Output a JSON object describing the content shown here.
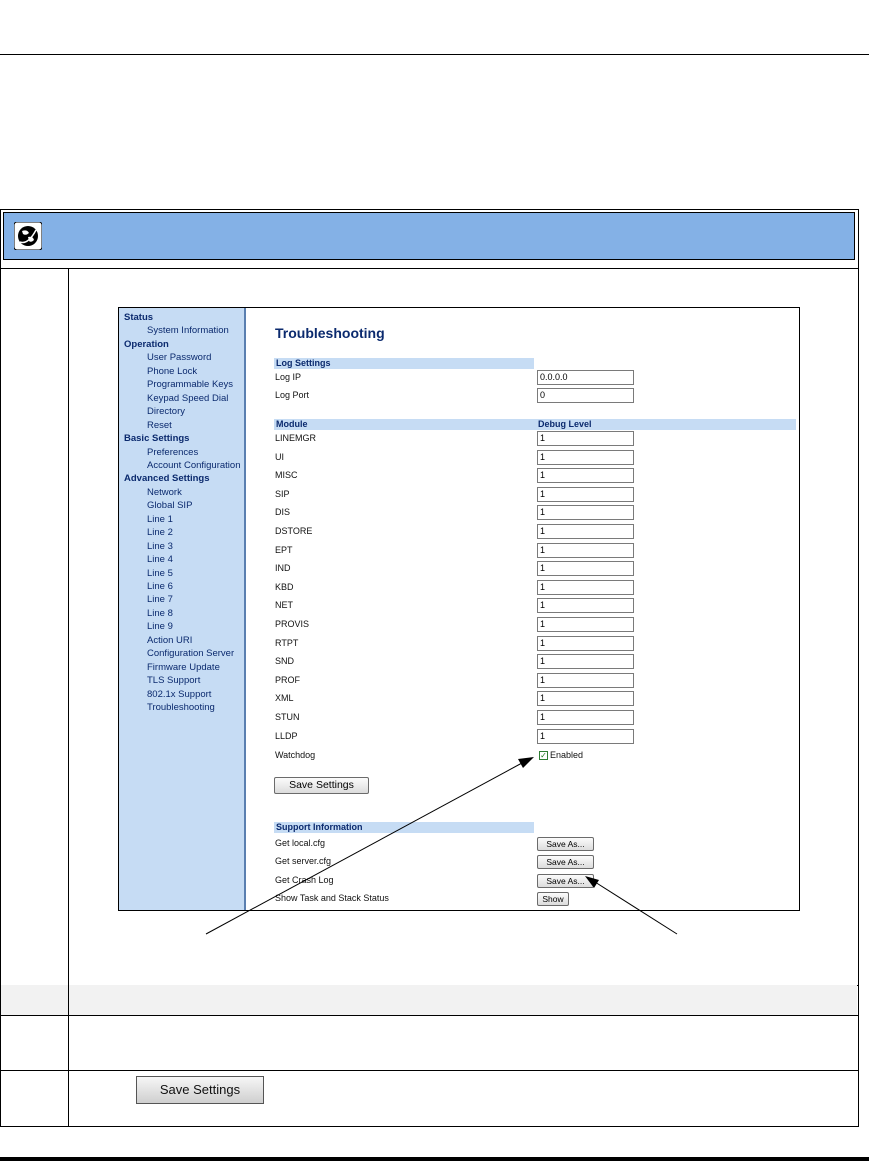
{
  "webui": {
    "page_title": "Troubleshooting",
    "nav": [
      {
        "label": "Status",
        "level": "h"
      },
      {
        "label": "System Information",
        "level": "s"
      },
      {
        "label": "Operation",
        "level": "h"
      },
      {
        "label": "User Password",
        "level": "s"
      },
      {
        "label": "Phone Lock",
        "level": "s"
      },
      {
        "label": "Programmable Keys",
        "level": "s"
      },
      {
        "label": "Keypad Speed Dial",
        "level": "s"
      },
      {
        "label": "Directory",
        "level": "s"
      },
      {
        "label": "Reset",
        "level": "s"
      },
      {
        "label": "Basic Settings",
        "level": "h"
      },
      {
        "label": "Preferences",
        "level": "s"
      },
      {
        "label": "Account Configuration",
        "level": "s"
      },
      {
        "label": "Advanced Settings",
        "level": "h"
      },
      {
        "label": "Network",
        "level": "s"
      },
      {
        "label": "Global SIP",
        "level": "s"
      },
      {
        "label": "Line 1",
        "level": "s"
      },
      {
        "label": "Line 2",
        "level": "s"
      },
      {
        "label": "Line 3",
        "level": "s"
      },
      {
        "label": "Line 4",
        "level": "s"
      },
      {
        "label": "Line 5",
        "level": "s"
      },
      {
        "label": "Line 6",
        "level": "s"
      },
      {
        "label": "Line 7",
        "level": "s"
      },
      {
        "label": "Line 8",
        "level": "s"
      },
      {
        "label": "Line 9",
        "level": "s"
      },
      {
        "label": "Action URI",
        "level": "s"
      },
      {
        "label": "Configuration Server",
        "level": "s"
      },
      {
        "label": "Firmware Update",
        "level": "s"
      },
      {
        "label": "TLS Support",
        "level": "s"
      },
      {
        "label": "802.1x Support",
        "level": "s"
      },
      {
        "label": "Troubleshooting",
        "level": "s"
      }
    ],
    "log_settings": {
      "header": "Log Settings",
      "rows": [
        {
          "label": "Log IP",
          "value": "0.0.0.0"
        },
        {
          "label": "Log Port",
          "value": "0"
        }
      ]
    },
    "modules": {
      "header_module": "Module",
      "header_level": "Debug Level",
      "rows": [
        {
          "label": "LINEMGR",
          "value": "1"
        },
        {
          "label": "UI",
          "value": "1"
        },
        {
          "label": "MISC",
          "value": "1"
        },
        {
          "label": "SIP",
          "value": "1"
        },
        {
          "label": "DIS",
          "value": "1"
        },
        {
          "label": "DSTORE",
          "value": "1"
        },
        {
          "label": "EPT",
          "value": "1"
        },
        {
          "label": "IND",
          "value": "1"
        },
        {
          "label": "KBD",
          "value": "1"
        },
        {
          "label": "NET",
          "value": "1"
        },
        {
          "label": "PROVIS",
          "value": "1"
        },
        {
          "label": "RTPT",
          "value": "1"
        },
        {
          "label": "SND",
          "value": "1"
        },
        {
          "label": "PROF",
          "value": "1"
        },
        {
          "label": "XML",
          "value": "1"
        },
        {
          "label": "STUN",
          "value": "1"
        },
        {
          "label": "LLDP",
          "value": "1"
        }
      ]
    },
    "watchdog": {
      "label": "Watchdog",
      "checked": true,
      "option_label": "Enabled"
    },
    "save_settings_label": "Save Settings",
    "support": {
      "header": "Support Information",
      "rows": [
        {
          "label": "Get local.cfg",
          "button": "Save As..."
        },
        {
          "label": "Get server.cfg",
          "button": "Save As..."
        },
        {
          "label": "Get Crash Log",
          "button": "Save As..."
        },
        {
          "label": "Show Task and Stack Status",
          "button": "Show"
        }
      ]
    }
  },
  "doc": {
    "save_settings_image_label": "Save Settings"
  },
  "colors": {
    "header_blue": "#84b1e6",
    "sidebar_blue": "#c6dcf4",
    "nav_text": "#0b2a6e"
  }
}
